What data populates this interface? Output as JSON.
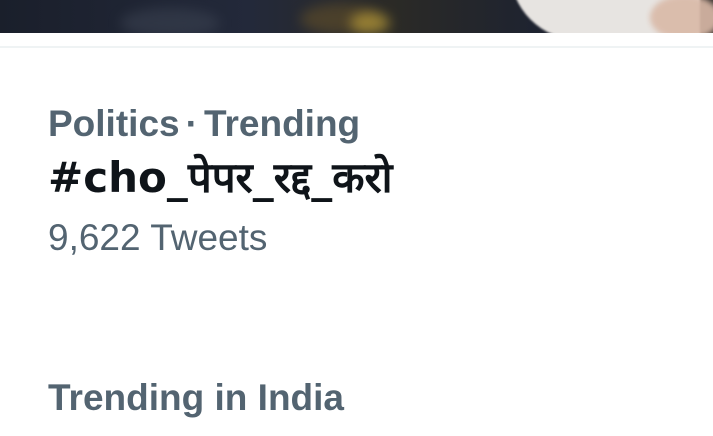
{
  "banner": {
    "icon": "trend-banner-image"
  },
  "trend": {
    "category": "Politics",
    "separator": "·",
    "status": "Trending",
    "name": "#cho_पेपर_रद्द_करो",
    "count": "9,622 Tweets"
  },
  "next_section": {
    "title": "Trending in India"
  },
  "colors": {
    "muted_text": "#536471",
    "primary_text": "#0f1419",
    "divider": "#eff3f4",
    "background": "#ffffff"
  }
}
